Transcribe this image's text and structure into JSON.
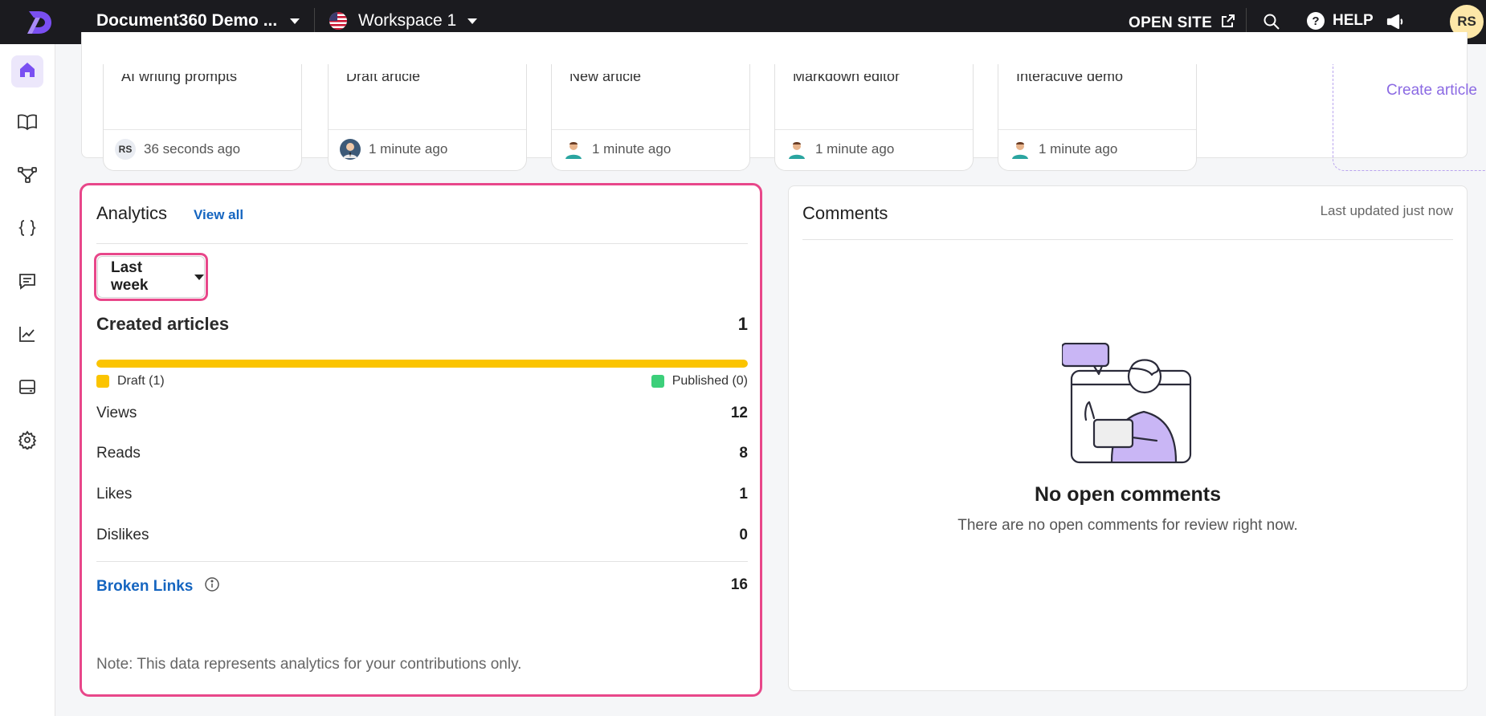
{
  "topbar": {
    "project_name": "Document360 Demo ...",
    "workspace_name": "Workspace 1",
    "open_site_label": "OPEN SITE",
    "help_label": "HELP",
    "help_glyph": "?",
    "user_initials": "RS"
  },
  "sidenav": {
    "items": [
      {
        "name": "home",
        "active": true
      },
      {
        "name": "documentation"
      },
      {
        "name": "category-manager"
      },
      {
        "name": "api-documentation"
      },
      {
        "name": "feedback"
      },
      {
        "name": "analytics"
      },
      {
        "name": "widgets"
      },
      {
        "name": "settings"
      }
    ]
  },
  "recent_articles": [
    {
      "title": "AI writing prompts",
      "time": "36 seconds ago",
      "author_initials": "RS",
      "avatar": "initials"
    },
    {
      "title": "Draft article",
      "time": "1 minute ago",
      "avatar": "photo"
    },
    {
      "title": "New article",
      "time": "1 minute ago",
      "avatar": "person-icon"
    },
    {
      "title": "Markdown editor",
      "time": "1 minute ago",
      "avatar": "person-icon"
    },
    {
      "title": "Interactive demo",
      "time": "1 minute ago",
      "avatar": "person-icon"
    }
  ],
  "create_article_label": "Create article",
  "analytics": {
    "title": "Analytics",
    "view_all": "View all",
    "period": "Last week",
    "created_label": "Created articles",
    "created_value": "1",
    "draft_fraction": 1.0,
    "draft_legend": "Draft (1)",
    "published_legend": "Published (0)",
    "draft_color": "#fbc400",
    "published_color": "#3ccf7a",
    "views_label": "Views",
    "views_value": "12",
    "reads_label": "Reads",
    "reads_value": "8",
    "likes_label": "Likes",
    "likes_value": "1",
    "dislikes_label": "Dislikes",
    "dislikes_value": "0",
    "broken_links_label": "Broken Links",
    "broken_links_value": "16",
    "note": "Note: This data represents analytics for your contributions only."
  },
  "comments": {
    "title": "Comments",
    "last_updated": "Last updated just now",
    "empty_title": "No open comments",
    "empty_subtitle": "There are no open comments for review right now."
  },
  "colors": {
    "accent": "#8b6ae3",
    "highlight": "#e8478a",
    "link": "#1565c0"
  }
}
